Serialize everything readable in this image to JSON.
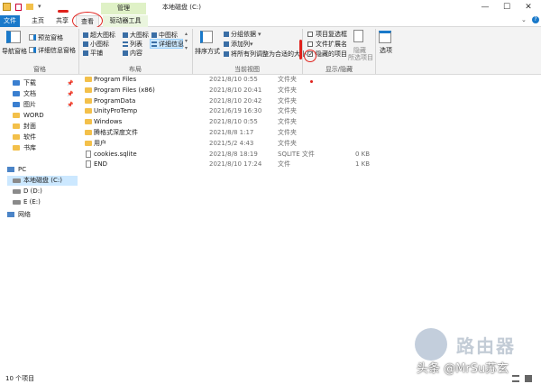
{
  "window": {
    "title": "本地磁盘 (C:)",
    "manage_label": "管理",
    "minimize": "—",
    "maximize": "☐",
    "close": "✕"
  },
  "tabs": {
    "file": "文件",
    "home": "主页",
    "share": "共享",
    "view": "查看",
    "drive_tools": "驱动器工具"
  },
  "ribbon": {
    "groups": {
      "pane": "窗格",
      "layout": "布局",
      "current_view": "当前视图",
      "show_hide": "显示/隐藏"
    },
    "pane": {
      "nav_pane": "导航窗格",
      "preview_pane": "预览窗格",
      "details_pane": "详细信息窗格"
    },
    "layout": {
      "extra_large": "超大图标",
      "large": "大图标",
      "medium": "中图标",
      "small": "小图标",
      "list": "列表",
      "details": "详细信息",
      "tiles": "平铺",
      "content": "内容"
    },
    "current_view": {
      "sort": "排序方式",
      "group_by": "分组依据",
      "add_columns": "添加列",
      "size_all": "将所有列调整为合适的大小"
    },
    "show_hide": {
      "item_checkboxes": "项目复选框",
      "file_extensions": "文件扩展名",
      "hidden_items": "隐藏的项目",
      "hide_selected_1": "隐藏",
      "hide_selected_2": "所选项目",
      "options": "选项"
    },
    "checks": {
      "item_checkboxes": false,
      "file_extensions": false,
      "hidden_items": true
    }
  },
  "sidebar": {
    "quick_access": [
      {
        "label": "下载",
        "pinned": true
      },
      {
        "label": "文档",
        "pinned": true
      },
      {
        "label": "图片",
        "pinned": true
      },
      {
        "label": "WORD",
        "pinned": false
      },
      {
        "label": "封面",
        "pinned": false
      },
      {
        "label": "软件",
        "pinned": false
      },
      {
        "label": "书库",
        "pinned": false
      }
    ],
    "pc": "PC",
    "drives": [
      "本地磁盘 (C:)",
      "D (D:)",
      "E (E:)"
    ],
    "network": "网络"
  },
  "files": [
    {
      "name": "Program Files",
      "date": "2021/8/10 0:55",
      "type": "文件夹",
      "size": "",
      "kind": "folder"
    },
    {
      "name": "Program Files (x86)",
      "date": "2021/8/10 20:41",
      "type": "文件夹",
      "size": "",
      "kind": "folder"
    },
    {
      "name": "ProgramData",
      "date": "2021/8/10 20:42",
      "type": "文件夹",
      "size": "",
      "kind": "folder"
    },
    {
      "name": "UnityProTemp",
      "date": "2021/6/19 16:30",
      "type": "文件夹",
      "size": "",
      "kind": "folder"
    },
    {
      "name": "Windows",
      "date": "2021/8/10 0:55",
      "type": "文件夹",
      "size": "",
      "kind": "folder"
    },
    {
      "name": "腾格式深度文件",
      "date": "2021/8/8 1:17",
      "type": "文件夹",
      "size": "",
      "kind": "folder"
    },
    {
      "name": "用户",
      "date": "2021/5/2 4:43",
      "type": "文件夹",
      "size": "",
      "kind": "folder"
    },
    {
      "name": "cookies.sqlite",
      "date": "2021/8/8 18:19",
      "type": "SQLITE 文件",
      "size": "0 KB",
      "kind": "file"
    },
    {
      "name": "END",
      "date": "2021/8/10 17:24",
      "type": "文件",
      "size": "1 KB",
      "kind": "file"
    }
  ],
  "status": {
    "count": "10 个项目"
  },
  "watermark": {
    "brand": "路由器",
    "author": "头条 @MrSu苏玄"
  },
  "colors": {
    "accent": "#1979ca",
    "manage": "#dff1c6",
    "annotation": "#e0211c",
    "selected": "#cce8ff"
  }
}
